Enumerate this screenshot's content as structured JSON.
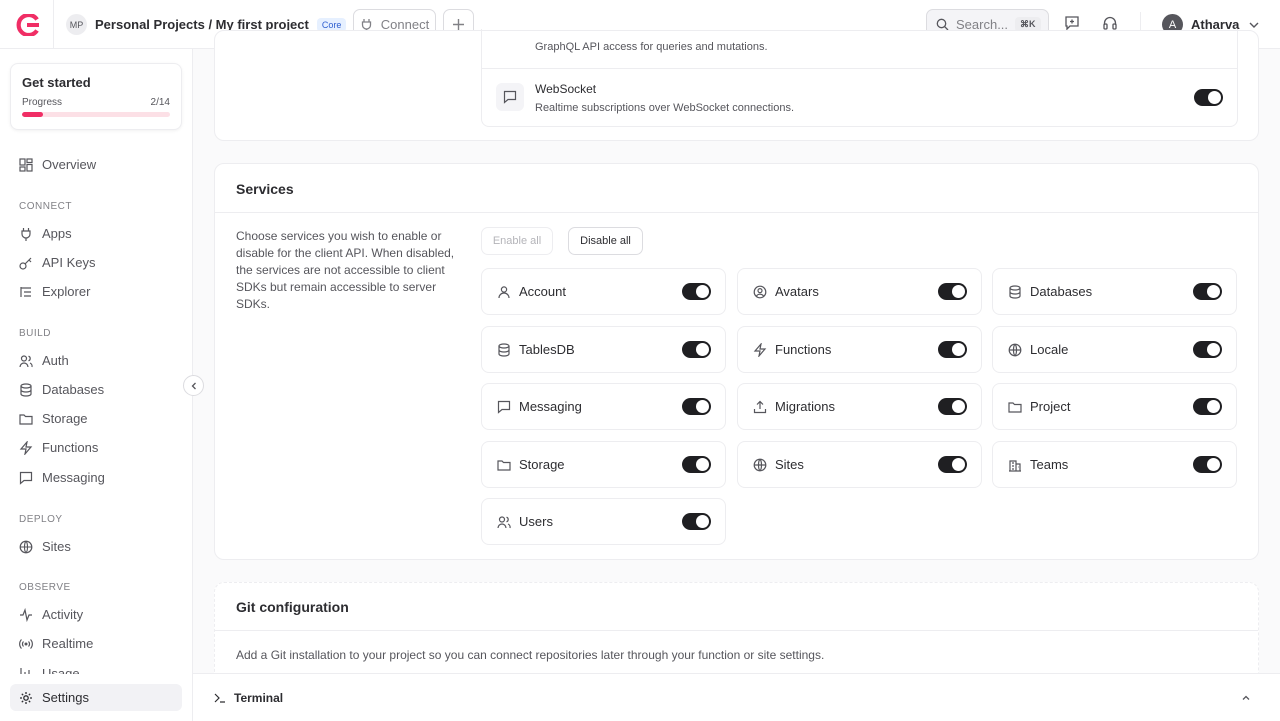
{
  "header": {
    "project_initials": "MP",
    "project_path": "Personal Projects / My first project",
    "plan_badge": "Core",
    "connect_label": "Connect",
    "search_placeholder": "Search...",
    "search_shortcut": "⌘K",
    "user_initial": "A",
    "user_name": "Atharva"
  },
  "get_started": {
    "title": "Get started",
    "progress_label": "Progress",
    "progress_text": "2/14",
    "progress_fraction": 0.143
  },
  "sidebar": {
    "overview": "Overview",
    "sections": {
      "connect": "CONNECT",
      "build": "BUILD",
      "deploy": "DEPLOY",
      "observe": "OBSERVE"
    },
    "items": {
      "apps": "Apps",
      "api_keys": "API Keys",
      "explorer": "Explorer",
      "auth": "Auth",
      "databases": "Databases",
      "storage": "Storage",
      "functions": "Functions",
      "messaging": "Messaging",
      "sites": "Sites",
      "activity": "Activity",
      "realtime": "Realtime",
      "usage": "Usage",
      "settings": "Settings"
    }
  },
  "apis": {
    "graphql_desc": "GraphQL API access for queries and mutations.",
    "websocket_title": "WebSocket",
    "websocket_desc": "Realtime subscriptions over WebSocket connections."
  },
  "services": {
    "title": "Services",
    "description": "Choose services you wish to enable or disable for the client API. When disabled, the services are not accessible to client SDKs but remain accessible to server SDKs.",
    "enable_all": "Enable all",
    "disable_all": "Disable all",
    "items": [
      {
        "label": "Account",
        "icon": "user-icon",
        "enabled": true
      },
      {
        "label": "Avatars",
        "icon": "user-circle-icon",
        "enabled": true
      },
      {
        "label": "Databases",
        "icon": "database-icon",
        "enabled": true
      },
      {
        "label": "TablesDB",
        "icon": "database-icon",
        "enabled": true
      },
      {
        "label": "Functions",
        "icon": "lightning-icon",
        "enabled": true
      },
      {
        "label": "Locale",
        "icon": "globe-icon",
        "enabled": true
      },
      {
        "label": "Messaging",
        "icon": "chat-icon",
        "enabled": true
      },
      {
        "label": "Migrations",
        "icon": "upload-icon",
        "enabled": true
      },
      {
        "label": "Project",
        "icon": "folder-icon",
        "enabled": true
      },
      {
        "label": "Storage",
        "icon": "folder-icon",
        "enabled": true
      },
      {
        "label": "Sites",
        "icon": "globe-icon",
        "enabled": true
      },
      {
        "label": "Teams",
        "icon": "building-icon",
        "enabled": true
      },
      {
        "label": "Users",
        "icon": "users-icon",
        "enabled": true
      }
    ]
  },
  "git": {
    "title": "Git configuration",
    "description": "Add a Git installation to your project so you can connect repositories later through your function or site settings."
  },
  "terminal": {
    "label": "Terminal"
  }
}
